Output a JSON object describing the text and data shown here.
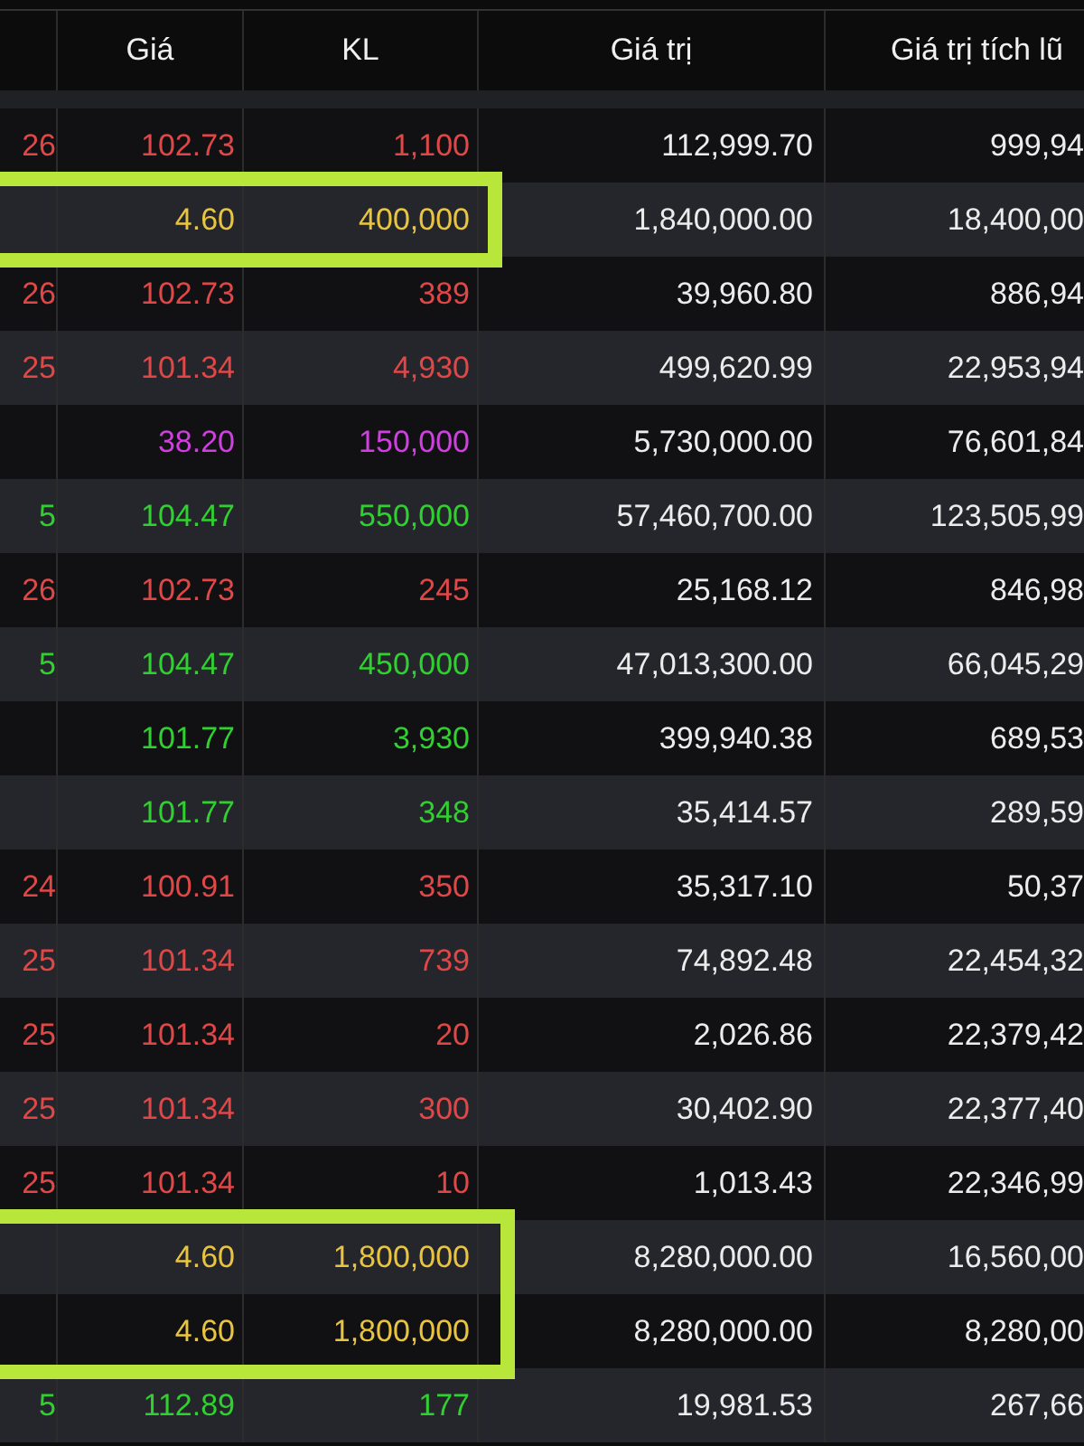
{
  "table": {
    "columns": [
      "Giá",
      "KL",
      "Giá trị",
      "Giá trị tích lũ"
    ],
    "rows": [
      {
        "column_1": "26",
        "price": "102.73",
        "volume": "1,100",
        "value": "112,999.70",
        "cumulative": "999,94",
        "color": "#e04848",
        "highlighted": false
      },
      {
        "column_1": "",
        "price": "4.60",
        "volume": "400,000",
        "value": "1,840,000.00",
        "cumulative": "18,400,00",
        "color": "#e8c440",
        "highlighted": true
      },
      {
        "column_1": "26",
        "price": "102.73",
        "volume": "389",
        "value": "39,960.80",
        "cumulative": "886,94",
        "color": "#e04848",
        "highlighted": false
      },
      {
        "column_1": "25",
        "price": "101.34",
        "volume": "4,930",
        "value": "499,620.99",
        "cumulative": "22,953,94",
        "color": "#e04848",
        "highlighted": false
      },
      {
        "column_1": "",
        "price": "38.20",
        "volume": "150,000",
        "value": "5,730,000.00",
        "cumulative": "76,601,84",
        "color": "#d040e0",
        "highlighted": false
      },
      {
        "column_1": "5",
        "price": "104.47",
        "volume": "550,000",
        "value": "57,460,700.00",
        "cumulative": "123,505,99",
        "color": "#30d030",
        "highlighted": false
      },
      {
        "column_1": "26",
        "price": "102.73",
        "volume": "245",
        "value": "25,168.12",
        "cumulative": "846,98",
        "color": "#e04848",
        "highlighted": false
      },
      {
        "column_1": "5",
        "price": "104.47",
        "volume": "450,000",
        "value": "47,013,300.00",
        "cumulative": "66,045,29",
        "color": "#30d030",
        "highlighted": false
      },
      {
        "column_1": "",
        "price": "101.77",
        "volume": "3,930",
        "value": "399,940.38",
        "cumulative": "689,53",
        "color": "#30d030",
        "highlighted": false
      },
      {
        "column_1": "",
        "price": "101.77",
        "volume": "348",
        "value": "35,414.57",
        "cumulative": "289,59",
        "color": "#30d030",
        "highlighted": false
      },
      {
        "column_1": "24",
        "price": "100.91",
        "volume": "350",
        "value": "35,317.10",
        "cumulative": "50,37",
        "color": "#e04848",
        "highlighted": false
      },
      {
        "column_1": "25",
        "price": "101.34",
        "volume": "739",
        "value": "74,892.48",
        "cumulative": "22,454,32",
        "color": "#e04848",
        "highlighted": false
      },
      {
        "column_1": "25",
        "price": "101.34",
        "volume": "20",
        "value": "2,026.86",
        "cumulative": "22,379,42",
        "color": "#e04848",
        "highlighted": false
      },
      {
        "column_1": "25",
        "price": "101.34",
        "volume": "300",
        "value": "30,402.90",
        "cumulative": "22,377,40",
        "color": "#e04848",
        "highlighted": false
      },
      {
        "column_1": "25",
        "price": "101.34",
        "volume": "10",
        "value": "1,013.43",
        "cumulative": "22,346,99",
        "color": "#e04848",
        "highlighted": false
      },
      {
        "column_1": "",
        "price": "4.60",
        "volume": "1,800,000",
        "value": "8,280,000.00",
        "cumulative": "16,560,00",
        "color": "#e8c440",
        "highlighted": true
      },
      {
        "column_1": "",
        "price": "4.60",
        "volume": "1,800,000",
        "value": "8,280,000.00",
        "cumulative": "8,280,00",
        "color": "#e8c440",
        "highlighted": true
      },
      {
        "column_1": "5",
        "price": "112.89",
        "volume": "177",
        "value": "19,981.53",
        "cumulative": "267,66",
        "color": "#30d030",
        "highlighted": false
      }
    ]
  }
}
